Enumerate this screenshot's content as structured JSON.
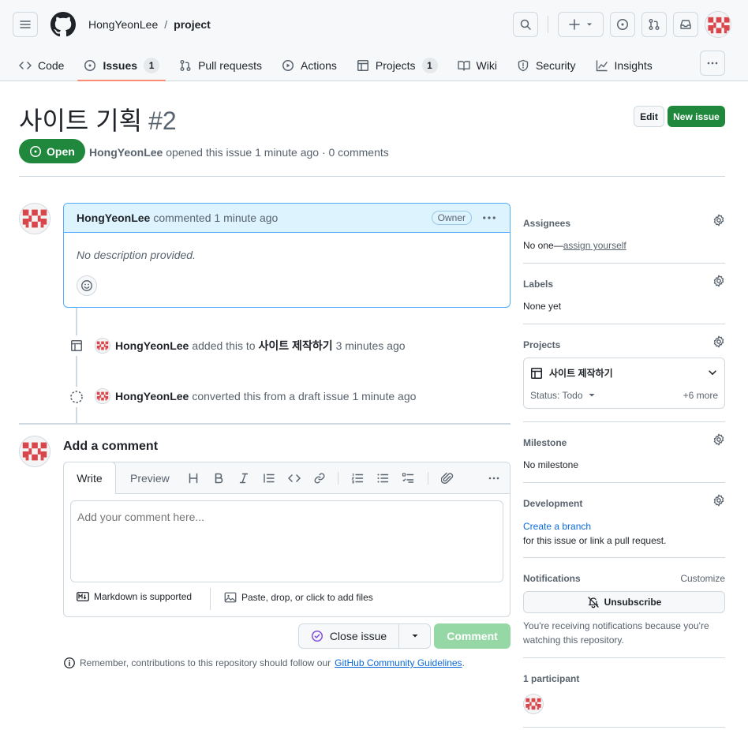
{
  "header": {
    "owner": "HongYeonLee",
    "separator": "/",
    "repo": "project"
  },
  "nav": {
    "code": "Code",
    "issues": "Issues",
    "issues_count": "1",
    "pull_requests": "Pull requests",
    "actions": "Actions",
    "projects": "Projects",
    "projects_count": "1",
    "wiki": "Wiki",
    "security": "Security",
    "insights": "Insights"
  },
  "issue": {
    "title": "사이트 기획",
    "number": "#2",
    "state": "Open",
    "author": "HongYeonLee",
    "meta_text": "opened this issue 1 minute ago · 0 comments",
    "edit_label": "Edit",
    "new_issue_label": "New issue"
  },
  "comment": {
    "author": "HongYeonLee",
    "action": "commented 1 minute ago",
    "owner_label": "Owner",
    "body": "No description provided."
  },
  "timeline": [
    {
      "author": "HongYeonLee",
      "text": "added this to",
      "project": "사이트 제작하기",
      "time": "3 minutes ago"
    },
    {
      "author": "HongYeonLee",
      "text": "converted this from a draft issue 1 minute ago"
    }
  ],
  "composer": {
    "title": "Add a comment",
    "tab_write": "Write",
    "tab_preview": "Preview",
    "placeholder": "Add your comment here...",
    "markdown_hint": "Markdown is supported",
    "attach_hint": "Paste, drop, or click to add files",
    "close_label": "Close issue",
    "comment_label": "Comment",
    "remember_text": "Remember, contributions to this repository should follow our",
    "guidelines_link": "GitHub Community Guidelines",
    "period": "."
  },
  "sidebar": {
    "assignees_title": "Assignees",
    "assignees_none": "No one—",
    "assign_yourself": "assign yourself",
    "labels_title": "Labels",
    "labels_value": "None yet",
    "projects_title": "Projects",
    "project_name": "사이트 제작하기",
    "project_status": "Status: Todo",
    "project_more": "+6 more",
    "milestone_title": "Milestone",
    "milestone_value": "No milestone",
    "development_title": "Development",
    "create_branch": "Create a branch",
    "development_text": "for this issue or link a pull request.",
    "notifications_title": "Notifications",
    "customize": "Customize",
    "unsubscribe": "Unsubscribe",
    "notify_reason_1": "You're receiving notifications because you're",
    "notify_reason_2": "watching this repository.",
    "participants_title": "1 participant"
  },
  "colors": {
    "open_green": "#1f883d",
    "accent_blue": "#0969da",
    "tab_underline": "#fd8c73",
    "avatar_red": "#d8454b"
  }
}
